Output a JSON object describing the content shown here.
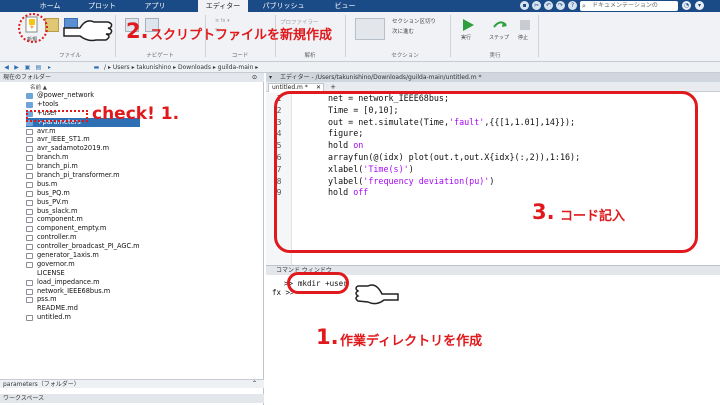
{
  "tabs": [
    "ホーム",
    "プロット",
    "アプリ",
    "エディター",
    "パブリッシュ",
    "ビュー"
  ],
  "search_placeholder": "ドキュメンテーションの",
  "toolstrip": {
    "new_label": "新規",
    "file_group": "ファイル",
    "navigate_group": "ナビゲート",
    "code_group": "コード",
    "analyze_group": "解析",
    "section_group": "セクション",
    "run_group": "実行",
    "profiler_label": "プロファイラー",
    "section_split": "セクション区切り",
    "next_run": "次に進む",
    "run_label": "実行",
    "step_label": "ステップ",
    "stop_label": "停止"
  },
  "path": {
    "segments": [
      "/",
      "Users",
      "takunishino",
      "Downloads",
      "guilda-main"
    ]
  },
  "folder_panel": {
    "title": "現在のフォルダー",
    "name_header": "名前 ▲",
    "items": [
      {
        "name": "@power_network",
        "type": "folder"
      },
      {
        "name": "+tools",
        "type": "folder"
      },
      {
        "name": "+user",
        "type": "folder"
      },
      {
        "name": "+parameters",
        "type": "folder",
        "selected": true
      },
      {
        "name": "avr.m",
        "type": "m"
      },
      {
        "name": "avr_IEEE_ST1.m",
        "type": "m"
      },
      {
        "name": "avr_sadamoto2019.m",
        "type": "m"
      },
      {
        "name": "branch.m",
        "type": "m"
      },
      {
        "name": "branch_pi.m",
        "type": "m"
      },
      {
        "name": "branch_pi_transformer.m",
        "type": "m"
      },
      {
        "name": "bus.m",
        "type": "m"
      },
      {
        "name": "bus_PQ.m",
        "type": "m"
      },
      {
        "name": "bus_PV.m",
        "type": "m"
      },
      {
        "name": "bus_slack.m",
        "type": "m"
      },
      {
        "name": "component.m",
        "type": "m"
      },
      {
        "name": "component_empty.m",
        "type": "m"
      },
      {
        "name": "controller.m",
        "type": "m"
      },
      {
        "name": "controller_broadcast_PI_AGC.m",
        "type": "m"
      },
      {
        "name": "generator_1axis.m",
        "type": "m"
      },
      {
        "name": "governor.m",
        "type": "m"
      },
      {
        "name": "LICENSE",
        "type": "blank"
      },
      {
        "name": "load_impedance.m",
        "type": "m"
      },
      {
        "name": "network_IEEE68bus.m",
        "type": "m"
      },
      {
        "name": "pss.m",
        "type": "m"
      },
      {
        "name": "README.md",
        "type": "blank"
      },
      {
        "name": "untitled.m",
        "type": "m"
      }
    ],
    "details_label": "parameters（フォルダー）",
    "workspace_label": "ワークスペース"
  },
  "editor": {
    "header": "エディター - /Users/takunishino/Downloads/guilda-main/untitled.m *",
    "tab_label": "untitled.m *",
    "lines": [
      [
        {
          "t": "net = network_IEEE68bus;",
          "c": ""
        }
      ],
      [
        {
          "t": "Time = [0,10];",
          "c": ""
        }
      ],
      [
        {
          "t": "out = net.simulate(Time,",
          "c": ""
        },
        {
          "t": "'fault'",
          "c": "str"
        },
        {
          "t": ",{{[1,1.01],14}});",
          "c": ""
        }
      ],
      [
        {
          "t": "figure;",
          "c": ""
        }
      ],
      [
        {
          "t": "hold ",
          "c": ""
        },
        {
          "t": "on",
          "c": "str"
        }
      ],
      [
        {
          "t": "arrayfun(@(idx) plot(out.t,out.X{idx}(:,2)),1:16);",
          "c": ""
        }
      ],
      [
        {
          "t": "xlabel(",
          "c": ""
        },
        {
          "t": "'Time(s)'",
          "c": "str"
        },
        {
          "t": ")",
          "c": ""
        }
      ],
      [
        {
          "t": "ylabel(",
          "c": ""
        },
        {
          "t": "'frequency deviation(pu)'",
          "c": "str"
        },
        {
          "t": ")",
          "c": ""
        }
      ],
      [
        {
          "t": "hold ",
          "c": ""
        },
        {
          "t": "off",
          "c": "str"
        }
      ]
    ]
  },
  "command_window": {
    "title": "コマンド ウィンドウ",
    "line1_prompt": ">>",
    "line1_cmd": "mkdir +user",
    "line2_prompt": "fx >>"
  },
  "annotations": {
    "step2_num": "2.",
    "step2_text": "スクリプトファイルを新規作成",
    "check_text": "check! 1.",
    "step3_num": "3.",
    "step3_text": "コード記入",
    "step1_num": "1.",
    "step1_text": "作業ディレクトリを作成"
  },
  "colors": {
    "accent": "#e0191c",
    "matlab_blue": "#1b4b86",
    "selection": "#2f6fb4"
  }
}
